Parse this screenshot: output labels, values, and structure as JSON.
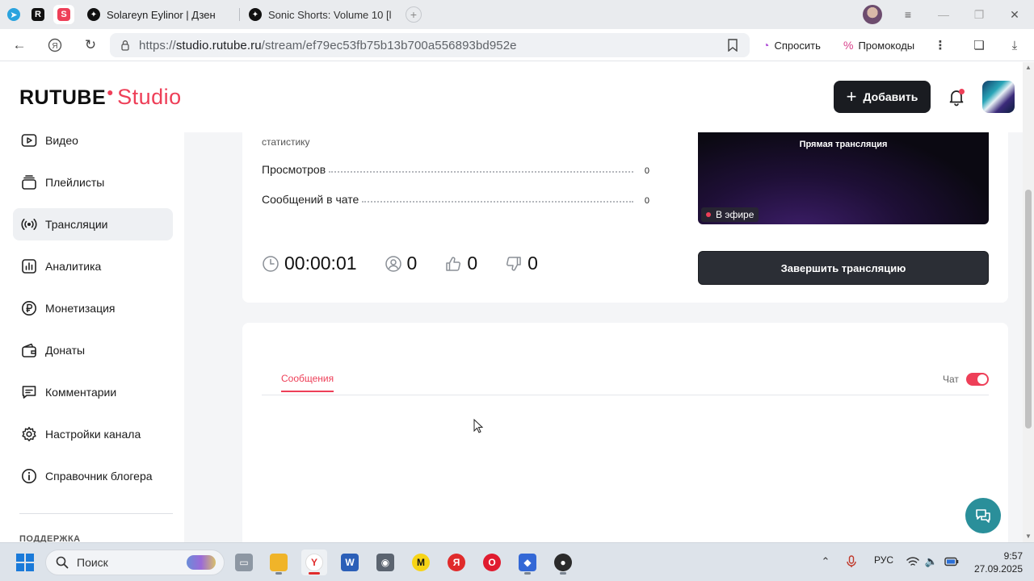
{
  "browser": {
    "tabs": [
      {
        "title": "Solareyn Eylinor | Дзен"
      },
      {
        "title": "Sonic Shorts: Volume 10 [l"
      }
    ],
    "url_prefix": "https://",
    "url_host": "studio.rutube.ru",
    "url_path": "/stream/ef79ec53fb75b13b700a556893bd952e",
    "ask_label": "Спросить",
    "promo_label": "Промокоды"
  },
  "header": {
    "logo_main": "RUTUBE",
    "logo_sub": "Studio",
    "add_label": "Добавить"
  },
  "sidebar": {
    "items": [
      {
        "label": "Видео",
        "icon": "play-icon"
      },
      {
        "label": "Плейлисты",
        "icon": "playlist-icon"
      },
      {
        "label": "Трансляции",
        "icon": "broadcast-icon",
        "active": true
      },
      {
        "label": "Аналитика",
        "icon": "chart-icon"
      },
      {
        "label": "Монетизация",
        "icon": "ruble-icon"
      },
      {
        "label": "Донаты",
        "icon": "wallet-icon"
      },
      {
        "label": "Комментарии",
        "icon": "comment-icon"
      },
      {
        "label": "Настройки канала",
        "icon": "gear-icon"
      },
      {
        "label": "Справочник блогера",
        "icon": "info-icon"
      }
    ],
    "section_support": "ПОДДЕРЖКА"
  },
  "stream": {
    "note": "статистику",
    "stats": [
      {
        "label": "Просмотров",
        "value": "0"
      },
      {
        "label": "Сообщений в чате",
        "value": "0"
      }
    ],
    "timer": "00:00:01",
    "viewers": "0",
    "likes": "0",
    "dislikes": "0",
    "preview_title": "Прямая трансляция",
    "live_label": "В эфире",
    "end_label": "Завершить трансляцию"
  },
  "chat": {
    "tab_label": "Сообщения",
    "toggle_label": "Чат",
    "toggle_on": true
  },
  "taskbar": {
    "search_label": "Поиск",
    "lang": "РУС",
    "time": "9:57",
    "date": "27.09.2025"
  },
  "colors": {
    "accent": "#ee3f58",
    "dark_button": "#1a1c21",
    "help_fab": "#2a8f9a"
  }
}
